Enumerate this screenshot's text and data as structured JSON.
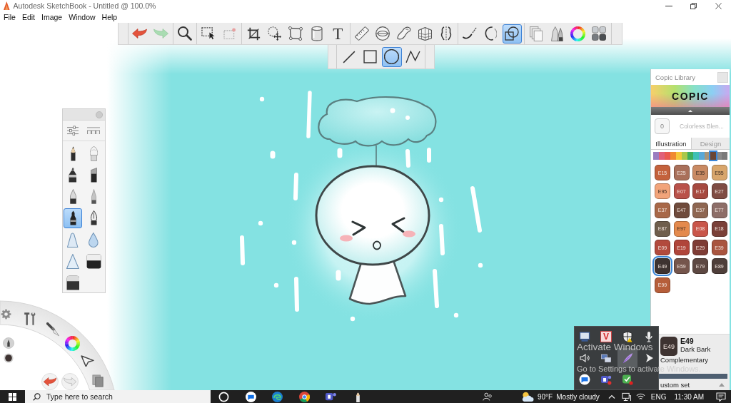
{
  "window": {
    "title": "Autodesk SketchBook - Untitled @ 100.0%"
  },
  "menu": [
    "File",
    "Edit",
    "Image",
    "Window",
    "Help"
  ],
  "toolbar": {
    "groups": [
      [
        {
          "kind": "undo",
          "selected": false
        },
        {
          "kind": "redo",
          "selected": false
        }
      ],
      [
        {
          "kind": "zoom",
          "selected": false
        }
      ],
      [
        {
          "kind": "select",
          "selected": false
        },
        {
          "kind": "deselect",
          "selected": false
        }
      ],
      [
        {
          "kind": "crop",
          "selected": false
        },
        {
          "kind": "transform",
          "selected": false
        },
        {
          "kind": "distort",
          "selected": false
        },
        {
          "kind": "fill",
          "selected": false
        },
        {
          "kind": "text",
          "glyph": "T",
          "selected": false
        }
      ],
      [
        {
          "kind": "ruler",
          "selected": false
        },
        {
          "kind": "ellipse_guide",
          "selected": false
        },
        {
          "kind": "french_curve",
          "selected": false
        },
        {
          "kind": "perspective",
          "selected": false
        },
        {
          "kind": "symmetry",
          "selected": false
        }
      ],
      [
        {
          "kind": "steady_stroke",
          "selected": false
        },
        {
          "kind": "predictive_stroke",
          "selected": false
        },
        {
          "kind": "shapes",
          "selected": true
        }
      ],
      [
        {
          "kind": "copy",
          "selected": false
        },
        {
          "kind": "brush_library",
          "selected": false
        },
        {
          "kind": "color_wheel",
          "selected": false
        },
        {
          "kind": "copic",
          "selected": false
        }
      ]
    ]
  },
  "shape_toolbar": {
    "tools": [
      {
        "kind": "line",
        "selected": false
      },
      {
        "kind": "rectangle",
        "selected": false
      },
      {
        "kind": "ellipse",
        "selected": true
      },
      {
        "kind": "polyline",
        "selected": false
      }
    ]
  },
  "brush_palette": {
    "brushes": [
      {
        "kind": "pencil",
        "selected": false
      },
      {
        "kind": "airbrush",
        "selected": false
      },
      {
        "kind": "marker",
        "selected": false
      },
      {
        "kind": "chisel_marker",
        "selected": false
      },
      {
        "kind": "pen",
        "selected": false
      },
      {
        "kind": "fine_pen",
        "selected": false
      },
      {
        "kind": "technical_pen",
        "selected": true
      },
      {
        "kind": "ink_nib",
        "selected": false
      },
      {
        "kind": "cone",
        "selected": false
      },
      {
        "kind": "drop",
        "selected": false
      },
      {
        "kind": "triangle",
        "selected": false
      },
      {
        "kind": "eraser",
        "selected": false
      },
      {
        "kind": "block_eraser",
        "selected": false
      }
    ]
  },
  "copic_library": {
    "title": "Copic Library",
    "logo": "COPIC",
    "blender": {
      "code": "0",
      "name": "Colorless Blen..."
    },
    "tabs": [
      {
        "label": "Illustration",
        "selected": true
      },
      {
        "label": "Design",
        "selected": false
      }
    ],
    "families": [
      {
        "color": "#9a7cc0",
        "selected": false
      },
      {
        "color": "#e0607a",
        "selected": false
      },
      {
        "color": "#ea5a50",
        "selected": false
      },
      {
        "color": "#f08a30",
        "selected": false
      },
      {
        "color": "#f5c93a",
        "selected": false
      },
      {
        "color": "#a9c84a",
        "selected": false
      },
      {
        "color": "#3fae5c",
        "selected": false
      },
      {
        "color": "#3ec0b5",
        "selected": false
      },
      {
        "color": "#59a8d8",
        "selected": false
      },
      {
        "color": "#a8957a",
        "selected": false
      },
      {
        "color": "#6a4535",
        "selected": true
      },
      {
        "color": "#8a8a8a",
        "selected": false
      },
      {
        "color": "#7a7a7a",
        "selected": false
      }
    ],
    "swatches": [
      {
        "code": "E15",
        "color": "#c4623c",
        "selected": false
      },
      {
        "code": "E25",
        "color": "#a9705a",
        "selected": false
      },
      {
        "code": "E35",
        "color": "#c98a63",
        "selected": false
      },
      {
        "code": "E55",
        "color": "#d8a66c",
        "selected": false
      },
      {
        "code": "E95",
        "color": "#f2a47a",
        "selected": false
      },
      {
        "code": "E07",
        "color": "#b9524a",
        "selected": false
      },
      {
        "code": "E17",
        "color": "#a6493f",
        "selected": false
      },
      {
        "code": "E27",
        "color": "#7f4c43",
        "selected": false
      },
      {
        "code": "E37",
        "color": "#a86848",
        "selected": false
      },
      {
        "code": "E47",
        "color": "#6f4b3c",
        "selected": false
      },
      {
        "code": "E57",
        "color": "#8e6651",
        "selected": false
      },
      {
        "code": "E77",
        "color": "#8d6e68",
        "selected": false
      },
      {
        "code": "E87",
        "color": "#6f5e4c",
        "selected": false
      },
      {
        "code": "E97",
        "color": "#e48a4d",
        "selected": false
      },
      {
        "code": "E08",
        "color": "#c9564a",
        "selected": false
      },
      {
        "code": "E18",
        "color": "#7a4038",
        "selected": false
      },
      {
        "code": "E09",
        "color": "#b24a3d",
        "selected": false
      },
      {
        "code": "E19",
        "color": "#b0453a",
        "selected": false
      },
      {
        "code": "E29",
        "color": "#7e3c35",
        "selected": false
      },
      {
        "code": "E39",
        "color": "#a9553f",
        "selected": false
      },
      {
        "code": "E49",
        "color": "#3e3331",
        "selected": true
      },
      {
        "code": "E59",
        "color": "#75554c",
        "selected": false
      },
      {
        "code": "E79",
        "color": "#5d4842",
        "selected": false
      },
      {
        "code": "E89",
        "color": "#4f3f3a",
        "selected": false
      },
      {
        "code": "E99",
        "color": "#b65e3a",
        "selected": false
      }
    ],
    "current": {
      "swatch_label": "E49",
      "code": "E49",
      "name": "Dark Bark",
      "color": "#3e3331"
    },
    "complementary_label": "Complementary",
    "set_label": "ustom set"
  },
  "tray": {
    "icons": [
      {
        "kind": "monitor",
        "hovered": false
      },
      {
        "kind": "letter_badge",
        "glyph": "V",
        "hovered": false
      },
      {
        "kind": "shield",
        "hovered": false
      },
      {
        "kind": "microphone",
        "hovered": false
      },
      {
        "kind": "speaker",
        "hovered": false
      },
      {
        "kind": "network",
        "hovered": false
      },
      {
        "kind": "feather",
        "hovered": true
      },
      {
        "kind": "arrow",
        "hovered": false
      },
      {
        "kind": "chat_bubble",
        "hovered": false
      },
      {
        "kind": "people_tile",
        "hovered": false
      },
      {
        "kind": "check_badge",
        "hovered": false
      }
    ]
  },
  "activation": {
    "title": "Activate Windows",
    "hint": "Go to Settings to activate Windows."
  },
  "taskbar": {
    "search": {
      "placeholder": "Type here to search"
    },
    "temperature": "90°F",
    "weather": "Mostly cloudy",
    "language": "ENG",
    "time": "11:30 AM"
  }
}
